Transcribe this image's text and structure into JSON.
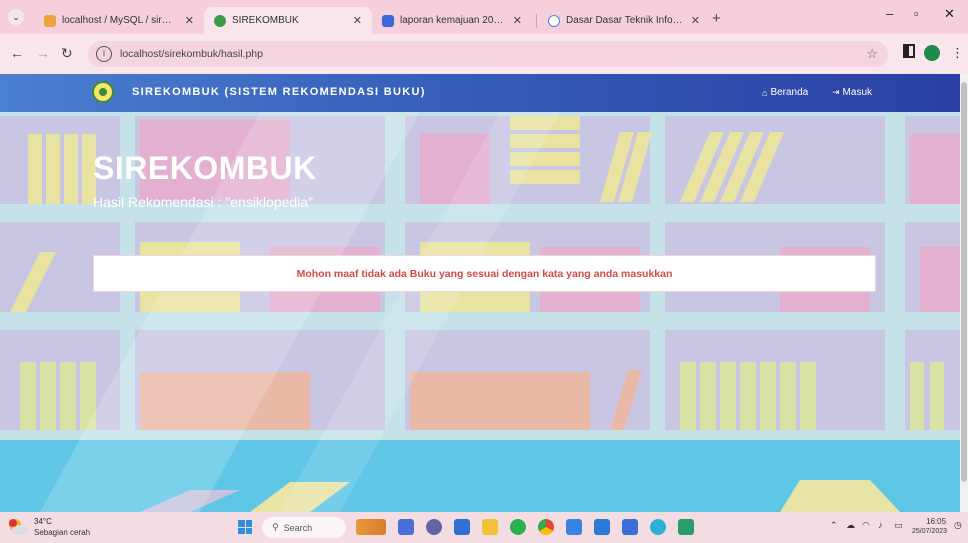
{
  "browser": {
    "tabs": [
      {
        "label": "localhost / MySQL / sirekomb",
        "favicon_color": "#e8a33d",
        "active": false
      },
      {
        "label": "SIREKOMBUK",
        "favicon_color": "#3b9a47",
        "active": true
      },
      {
        "label": "laporan kemajuan 2022.docx",
        "favicon_color": "#3a66d6",
        "active": false
      },
      {
        "label": "Dasar Dasar Teknik Informatika",
        "favicon_color": "#4a84e8",
        "active": false
      }
    ],
    "new_tab": "+",
    "url": "localhost/sirekombuk/hasil.php",
    "window_controls": {
      "minimize": "–",
      "maximize": "▫",
      "close": "✕"
    }
  },
  "site": {
    "brand": "SIREKOMBUK (SISTEM REKOMENDASI BUKU)",
    "nav": [
      {
        "label": "Beranda",
        "icon": "home-icon"
      },
      {
        "label": "Masuk",
        "icon": "login-icon"
      }
    ],
    "hero_title": "SIREKOMBUK",
    "hero_subtitle": "Hasil Rekomendasi : \"ensiklopedia\"",
    "message": "Mohon maaf tidak ada Buku yang sesuai dengan kata yang anda masukkan"
  },
  "taskbar": {
    "weather_temp": "34°C",
    "weather_desc": "Sebagian cerah",
    "search_placeholder": "Search",
    "clock_time": "16:05",
    "clock_date": "25/07/2023",
    "colors": {
      "start": "#2d8fe2"
    }
  }
}
